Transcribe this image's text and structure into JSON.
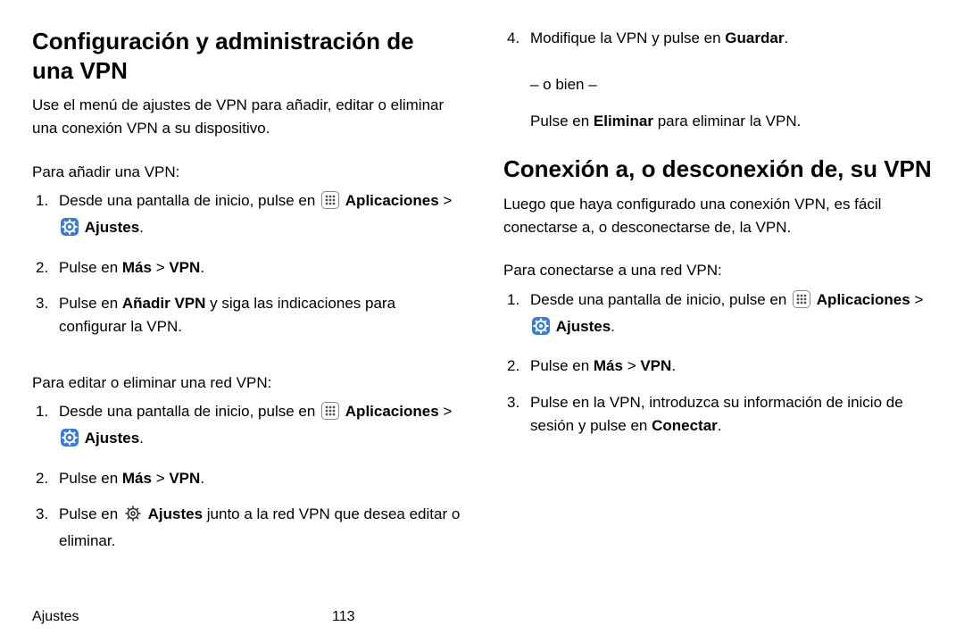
{
  "left": {
    "heading": "Configuración y administración de una VPN",
    "intro": "Use el menú de ajustes de VPN para añadir, editar o eliminar una conexión VPN a su dispositivo.",
    "add_lead": "Para añadir una VPN:",
    "add_steps": {
      "s1_pre": "Desde una pantalla de inicio, pulse en ",
      "s1_apps": "Aplicaciones",
      "s1_sep": " > ",
      "s1_settings": "Ajustes",
      "s1_post": ".",
      "s2_pre": "Pulse en ",
      "s2_b1": "Más",
      "s2_mid": " > ",
      "s2_b2": "VPN",
      "s2_post": ".",
      "s3_pre": "Pulse en ",
      "s3_b": "Añadir VPN",
      "s3_post": " y siga las indicaciones para configurar la VPN."
    },
    "edit_lead": "Para editar o eliminar una red VPN:",
    "edit_steps": {
      "s1_pre": "Desde una pantalla de inicio, pulse en ",
      "s1_apps": "Aplicaciones",
      "s1_sep": " > ",
      "s1_settings": "Ajustes",
      "s1_post": ".",
      "s2_pre": "Pulse en ",
      "s2_b1": "Más",
      "s2_mid": " > ",
      "s2_b2": "VPN",
      "s2_post": ".",
      "s3_pre": "Pulse en ",
      "s3_b": "Ajustes",
      "s3_post": " junto a la red VPN que desea editar o eliminar."
    }
  },
  "right": {
    "top_steps": {
      "s4_pre": "Modifique la VPN y pulse en ",
      "s4_b": "Guardar",
      "s4_post": ".",
      "or": "– o bien –",
      "alt_pre": "Pulse en ",
      "alt_b": "Eliminar",
      "alt_post": " para eliminar la VPN."
    },
    "heading": "Conexión a, o desconexión de, su VPN",
    "intro": "Luego que haya configurado una conexión VPN, es fácil conectarse a, o desconectarse de, la VPN.",
    "conn_lead": "Para conectarse a una red VPN:",
    "conn_steps": {
      "s1_pre": "Desde una pantalla de inicio, pulse en ",
      "s1_apps": "Aplicaciones",
      "s1_sep": " > ",
      "s1_settings": "Ajustes",
      "s1_post": ".",
      "s2_pre": "Pulse en ",
      "s2_b1": "Más",
      "s2_mid": " > ",
      "s2_b2": "VPN",
      "s2_post": ".",
      "s3_pre": "Pulse en la VPN, introduzca su información de inicio de sesión y pulse en ",
      "s3_b": "Conectar",
      "s3_post": "."
    }
  },
  "footer": {
    "section": "Ajustes",
    "page": "113"
  }
}
